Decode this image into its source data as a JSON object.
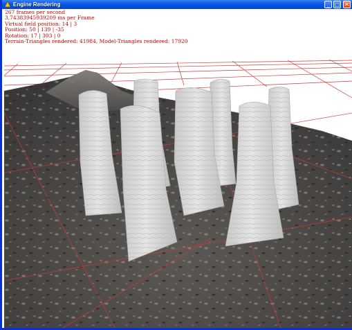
{
  "window": {
    "title": "Engine Rendering",
    "icon": "app-icon",
    "buttons": [
      {
        "name": "minimize-button",
        "icon": "minimize-icon",
        "glyph": "_"
      },
      {
        "name": "maximize-button",
        "icon": "maximize-icon",
        "glyph": "□"
      },
      {
        "name": "close-button",
        "icon": "close-icon",
        "glyph": "✕"
      }
    ]
  },
  "hud": {
    "fps": "267 frames per second",
    "ms_per_frame": "3,74383945939209 ms per Frame",
    "virtual_field": "Virtual field position: 14 | 3",
    "position": "Position: 50 | 139 | -35",
    "rotation": "Rotation: 17 | 303 | 0",
    "triangles": "Terrain-Triangles rendered: 41984, Model-Triangles rendered: 17920"
  },
  "colors": {
    "titlebar": "#0a5ce6",
    "hud_text": "#c00000",
    "grid_lines": "#d23a3a",
    "sky": "#ffffff",
    "terrain": "#4a4745",
    "models": "#d9d9d9"
  }
}
